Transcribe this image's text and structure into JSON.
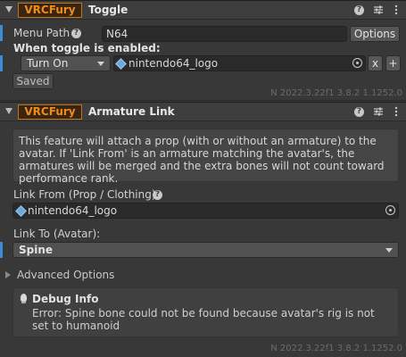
{
  "toggle": {
    "brand": "VRCFury",
    "title": "Toggle",
    "menu_path_label": "Menu Path",
    "menu_path_value": "N64",
    "options_button": "Options",
    "when_enabled_label": "When toggle is enabled:",
    "action_select": "Turn On",
    "object_name": "nintendo64_logo",
    "remove_button": "x",
    "add_button": "+",
    "saved_button": "Saved",
    "version": "N 2022.3.22f1 3.8.2 1.1252.0"
  },
  "armature": {
    "brand": "VRCFury",
    "title": "Armature Link",
    "description": "This feature will attach a prop (with or without an armature) to the avatar. If 'Link From' is an armature matching the avatar's, the armatures will be merged and the extra bones will not count toward performance rank.",
    "link_from_label": "Link From (Prop / Clothing)",
    "link_from_value": "nintendo64_logo",
    "link_to_label": "Link To (Avatar):",
    "link_to_value": "Spine",
    "advanced_label": "Advanced Options",
    "debug_title": "Debug Info",
    "debug_text": "Error: Spine bone could not be found because avatar's rig is not set to humanoid",
    "version": "N 2022.3.22f1 3.8.2 1.1252.0"
  },
  "header_icons": [
    "help-icon",
    "sliders-icon",
    "kebab-menu-icon"
  ],
  "colors": {
    "brand_orange": "#f28c17",
    "accent_blue": "#3b8ed6",
    "background": "#383838"
  }
}
